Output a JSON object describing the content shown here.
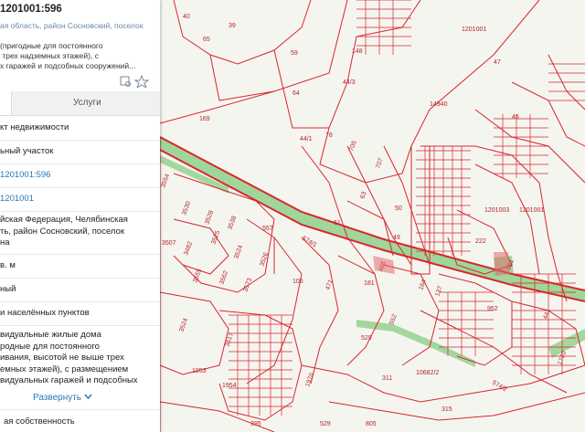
{
  "panel": {
    "cadastral_number": "1201001:596",
    "address_line": "ая область, район Сосновский, поселок",
    "description": "(пригодные для постоянного\n трех надземных этажей), с\nх гаражей и подсобных сооружений...",
    "icons": [
      "map-locate-icon",
      "star-icon"
    ],
    "tab_services": "Услуги",
    "rows": [
      "кт недвижимости",
      "ьный участок",
      "1201001:596",
      "1201001",
      "йская Федерация, Челябинская\nть, район Сосновский, поселок\nна",
      "в. м",
      "ный",
      "и населённых пунктов",
      "видуальные жилые дома\nродные для постоянного\nивания, высотой не выше трех\nемных этажей), с размещением\nвидуальных гаражей и подсобных"
    ],
    "expand_label": "Развернуть",
    "last_row": "ая собственность"
  },
  "map": {
    "parcels": [
      "40",
      "39",
      "65",
      "148",
      "59",
      "1201001",
      "47",
      "44/3",
      "64",
      "14940",
      "169",
      "46",
      "44/1",
      "78",
      "705",
      "707",
      "1201003",
      "50",
      "63",
      "49",
      "222",
      "3554",
      "557",
      "61",
      "3530",
      "3528",
      "3538",
      "3525",
      "3507",
      "3482",
      "3524",
      "3526",
      "574/1",
      "466",
      "1201001",
      "105",
      "471",
      "3555",
      "3562",
      "3573",
      "181",
      "137",
      "164",
      "952",
      "581",
      "441",
      "3524",
      "3617",
      "529",
      "552",
      "1953",
      "1954",
      "1970",
      "10682/2",
      "574/2",
      "1720",
      "315",
      "311",
      "805",
      "529",
      "395"
    ],
    "colors": {
      "boundary": "#d9262b",
      "green": "#7cc576",
      "background": "#f4f4ef"
    }
  }
}
